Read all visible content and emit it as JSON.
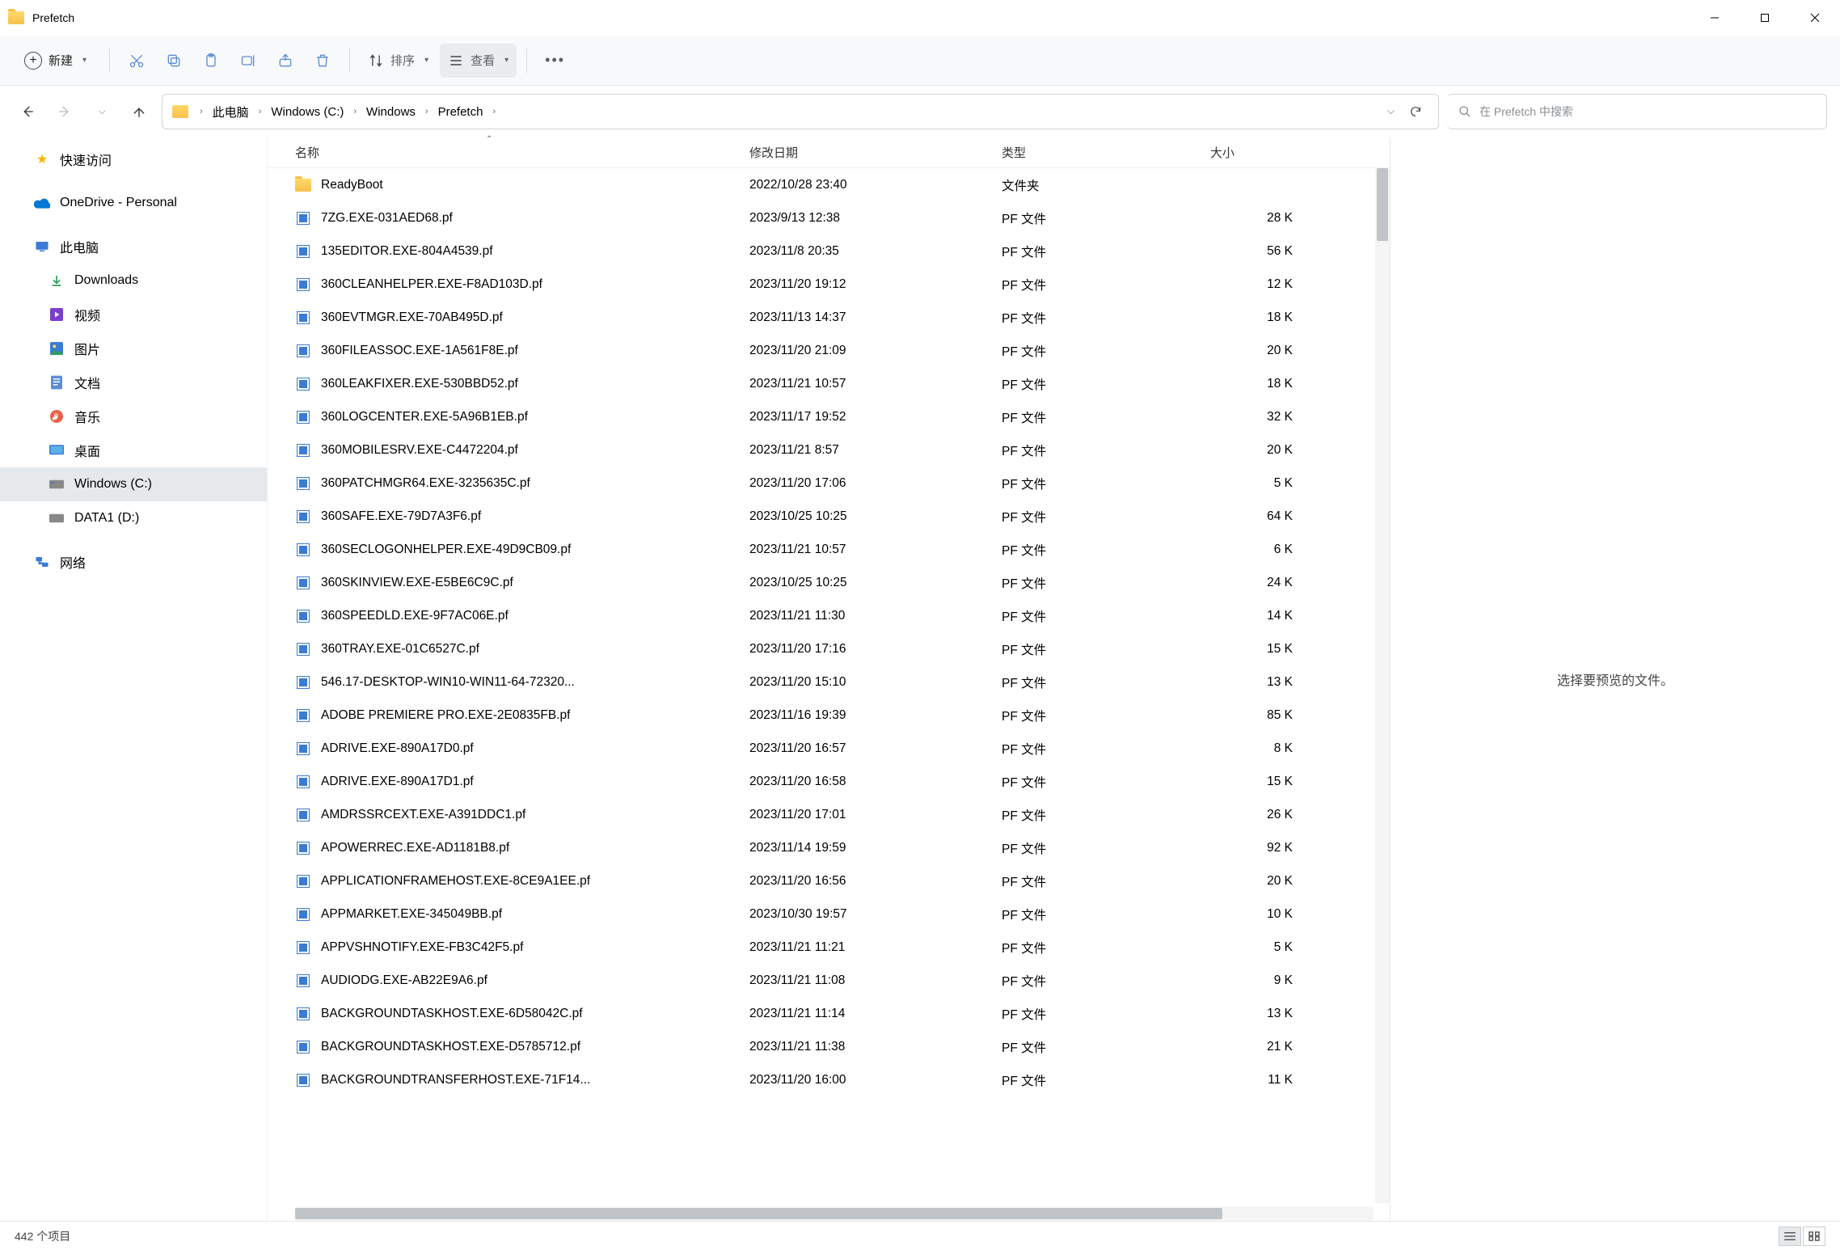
{
  "window": {
    "title": "Prefetch"
  },
  "toolbar": {
    "new_label": "新建",
    "sort_label": "排序",
    "view_label": "查看"
  },
  "breadcrumbs": [
    "此电脑",
    "Windows (C:)",
    "Windows",
    "Prefetch"
  ],
  "search": {
    "placeholder": "在 Prefetch 中搜索"
  },
  "sidebar": {
    "quick_access": "快速访问",
    "onedrive": "OneDrive - Personal",
    "this_pc": "此电脑",
    "downloads": "Downloads",
    "videos": "视频",
    "pictures": "图片",
    "documents": "文档",
    "music": "音乐",
    "desktop": "桌面",
    "windows_c": "Windows (C:)",
    "data1_d": "DATA1 (D:)",
    "network": "网络"
  },
  "columns": {
    "name": "名称",
    "date": "修改日期",
    "type": "类型",
    "size": "大小"
  },
  "type_folder": "文件夹",
  "type_pf": "PF 文件",
  "files": [
    {
      "name": "ReadyBoot",
      "date": "2022/10/28 23:40",
      "type": "folder",
      "size": ""
    },
    {
      "name": "7ZG.EXE-031AED68.pf",
      "date": "2023/9/13 12:38",
      "type": "pf",
      "size": "28 K"
    },
    {
      "name": "135EDITOR.EXE-804A4539.pf",
      "date": "2023/11/8 20:35",
      "type": "pf",
      "size": "56 K"
    },
    {
      "name": "360CLEANHELPER.EXE-F8AD103D.pf",
      "date": "2023/11/20 19:12",
      "type": "pf",
      "size": "12 K"
    },
    {
      "name": "360EVTMGR.EXE-70AB495D.pf",
      "date": "2023/11/13 14:37",
      "type": "pf",
      "size": "18 K"
    },
    {
      "name": "360FILEASSOC.EXE-1A561F8E.pf",
      "date": "2023/11/20 21:09",
      "type": "pf",
      "size": "20 K"
    },
    {
      "name": "360LEAKFIXER.EXE-530BBD52.pf",
      "date": "2023/11/21 10:57",
      "type": "pf",
      "size": "18 K"
    },
    {
      "name": "360LOGCENTER.EXE-5A96B1EB.pf",
      "date": "2023/11/17 19:52",
      "type": "pf",
      "size": "32 K"
    },
    {
      "name": "360MOBILESRV.EXE-C4472204.pf",
      "date": "2023/11/21 8:57",
      "type": "pf",
      "size": "20 K"
    },
    {
      "name": "360PATCHMGR64.EXE-3235635C.pf",
      "date": "2023/11/20 17:06",
      "type": "pf",
      "size": "5 K"
    },
    {
      "name": "360SAFE.EXE-79D7A3F6.pf",
      "date": "2023/10/25 10:25",
      "type": "pf",
      "size": "64 K"
    },
    {
      "name": "360SECLOGONHELPER.EXE-49D9CB09.pf",
      "date": "2023/11/21 10:57",
      "type": "pf",
      "size": "6 K"
    },
    {
      "name": "360SKINVIEW.EXE-E5BE6C9C.pf",
      "date": "2023/10/25 10:25",
      "type": "pf",
      "size": "24 K"
    },
    {
      "name": "360SPEEDLD.EXE-9F7AC06E.pf",
      "date": "2023/11/21 11:30",
      "type": "pf",
      "size": "14 K"
    },
    {
      "name": "360TRAY.EXE-01C6527C.pf",
      "date": "2023/11/20 17:16",
      "type": "pf",
      "size": "15 K"
    },
    {
      "name": "546.17-DESKTOP-WIN10-WIN11-64-72320...",
      "date": "2023/11/20 15:10",
      "type": "pf",
      "size": "13 K"
    },
    {
      "name": "ADOBE PREMIERE PRO.EXE-2E0835FB.pf",
      "date": "2023/11/16 19:39",
      "type": "pf",
      "size": "85 K"
    },
    {
      "name": "ADRIVE.EXE-890A17D0.pf",
      "date": "2023/11/20 16:57",
      "type": "pf",
      "size": "8 K"
    },
    {
      "name": "ADRIVE.EXE-890A17D1.pf",
      "date": "2023/11/20 16:58",
      "type": "pf",
      "size": "15 K"
    },
    {
      "name": "AMDRSSRCEXT.EXE-A391DDC1.pf",
      "date": "2023/11/20 17:01",
      "type": "pf",
      "size": "26 K"
    },
    {
      "name": "APOWERREC.EXE-AD1181B8.pf",
      "date": "2023/11/14 19:59",
      "type": "pf",
      "size": "92 K"
    },
    {
      "name": "APPLICATIONFRAMEHOST.EXE-8CE9A1EE.pf",
      "date": "2023/11/20 16:56",
      "type": "pf",
      "size": "20 K"
    },
    {
      "name": "APPMARKET.EXE-345049BB.pf",
      "date": "2023/10/30 19:57",
      "type": "pf",
      "size": "10 K"
    },
    {
      "name": "APPVSHNOTIFY.EXE-FB3C42F5.pf",
      "date": "2023/11/21 11:21",
      "type": "pf",
      "size": "5 K"
    },
    {
      "name": "AUDIODG.EXE-AB22E9A6.pf",
      "date": "2023/11/21 11:08",
      "type": "pf",
      "size": "9 K"
    },
    {
      "name": "BACKGROUNDTASKHOST.EXE-6D58042C.pf",
      "date": "2023/11/21 11:14",
      "type": "pf",
      "size": "13 K"
    },
    {
      "name": "BACKGROUNDTASKHOST.EXE-D5785712.pf",
      "date": "2023/11/21 11:38",
      "type": "pf",
      "size": "21 K"
    },
    {
      "name": "BACKGROUNDTRANSFERHOST.EXE-71F14...",
      "date": "2023/11/20 16:00",
      "type": "pf",
      "size": "11 K"
    }
  ],
  "preview": {
    "empty": "选择要预览的文件。"
  },
  "status": {
    "count": "442 个项目"
  }
}
